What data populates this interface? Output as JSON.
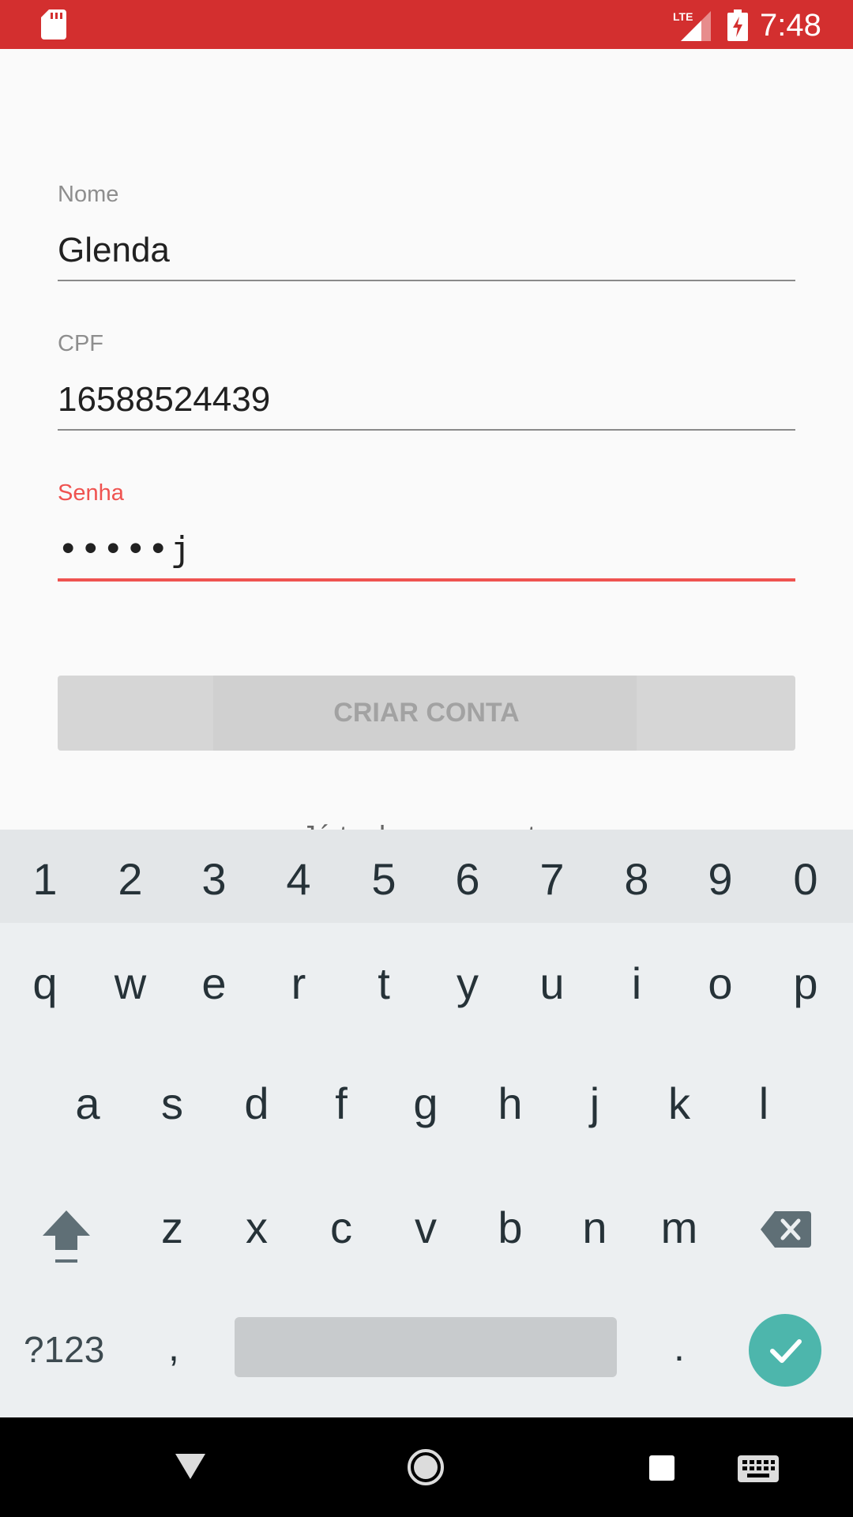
{
  "status_bar": {
    "time": "7:48",
    "network": "LTE",
    "icons": [
      "sd-card-icon",
      "lte-signal-icon",
      "battery-charging-icon"
    ],
    "color": "#d32f2f"
  },
  "form": {
    "name": {
      "label": "Nome",
      "value": "Glenda"
    },
    "cpf": {
      "label": "CPF",
      "value": "16588524439"
    },
    "password": {
      "label": "Senha",
      "value": "•••••j"
    },
    "create_button": "CRIAR CONTA",
    "login_link": "Já tenho uma conta",
    "accent_color": "#ef5350"
  },
  "keyboard": {
    "number_row": [
      "1",
      "2",
      "3",
      "4",
      "5",
      "6",
      "7",
      "8",
      "9",
      "0"
    ],
    "row1": [
      "q",
      "w",
      "e",
      "r",
      "t",
      "y",
      "u",
      "i",
      "o",
      "p"
    ],
    "row2": [
      "a",
      "s",
      "d",
      "f",
      "g",
      "h",
      "j",
      "k",
      "l"
    ],
    "row3": [
      "z",
      "x",
      "c",
      "v",
      "b",
      "n",
      "m"
    ],
    "symbols_key": "?123",
    "comma_key": ",",
    "period_key": ".",
    "icons": [
      "shift-icon",
      "backspace-icon",
      "check-icon"
    ],
    "enter_color": "#4db6ac"
  },
  "nav_bar": {
    "icons": [
      "back-icon",
      "home-icon",
      "recents-icon",
      "keyboard-icon"
    ]
  }
}
